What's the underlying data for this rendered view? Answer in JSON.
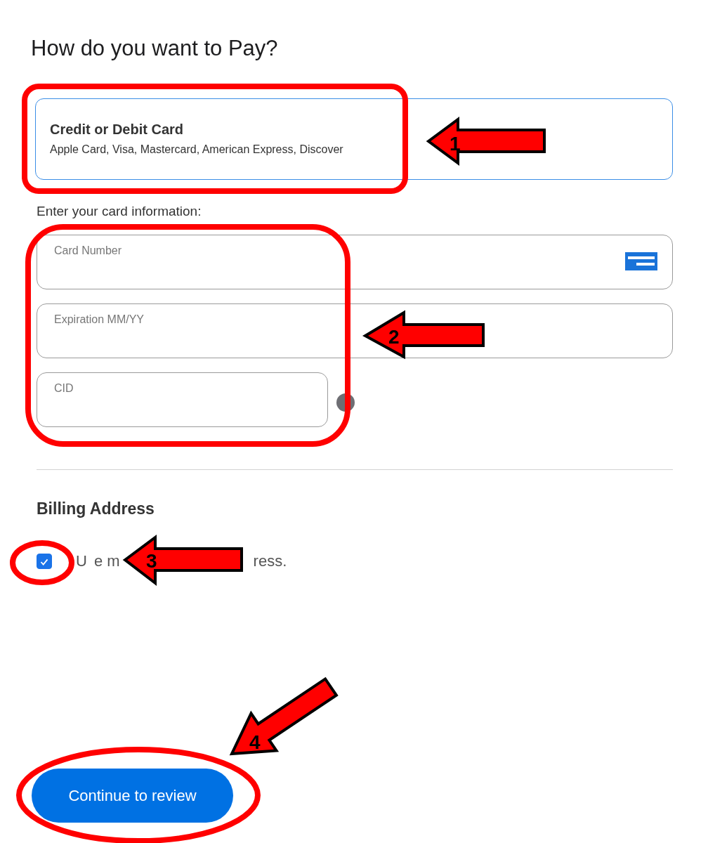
{
  "heading": "How do you want to Pay?",
  "payment_option": {
    "title": "Credit or Debit Card",
    "subtitle": "Apple Card, Visa, Mastercard, American Express, Discover",
    "selected": true
  },
  "card_prompt": "Enter your card information:",
  "fields": [
    {
      "placeholder": "Card Number",
      "kind": "card"
    },
    {
      "placeholder": "Expiration MM/YY",
      "kind": "wide"
    },
    {
      "placeholder": "CID",
      "kind": "short"
    }
  ],
  "billing": {
    "title": "Billing Address",
    "checkbox": {
      "checked": true,
      "label_parts": [
        "U",
        "e m",
        "ress."
      ]
    }
  },
  "button": "Continue to review",
  "annotations": [
    {
      "number": "1"
    },
    {
      "number": "2"
    },
    {
      "number": "3"
    },
    {
      "number": "4"
    }
  ]
}
